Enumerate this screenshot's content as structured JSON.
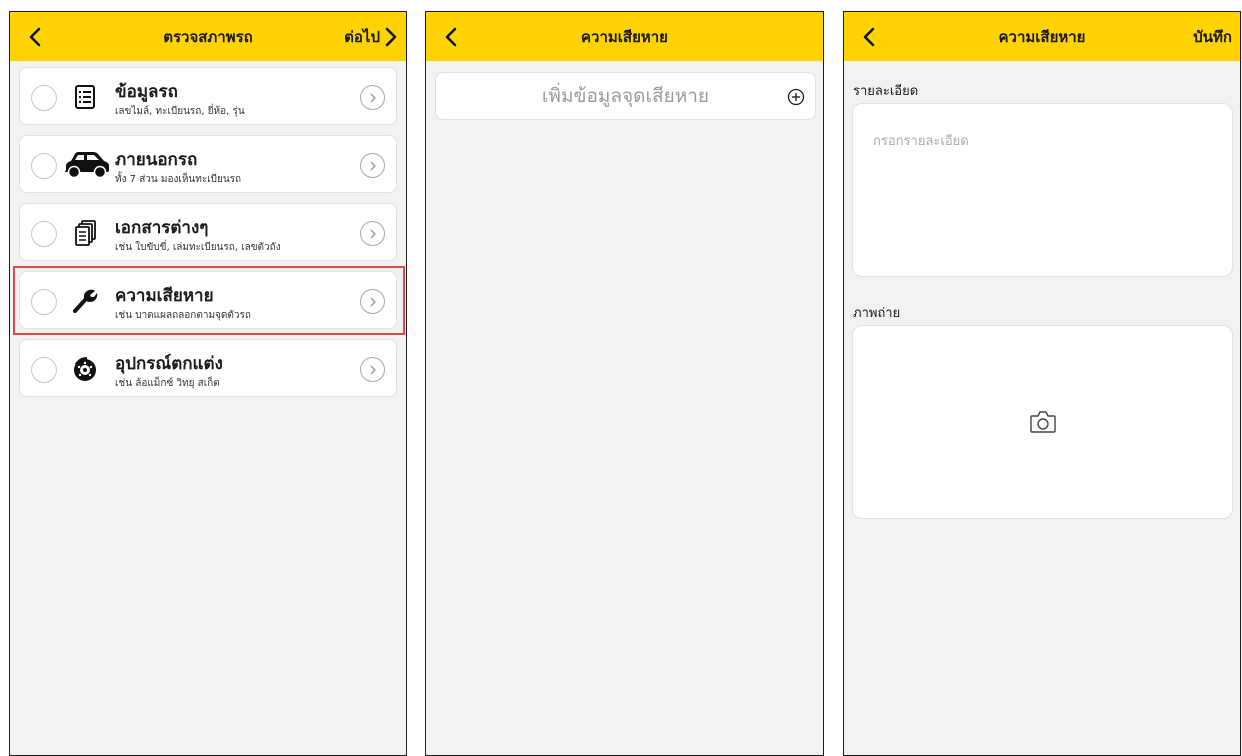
{
  "screen1": {
    "title": "ตรวจสภาพรถ",
    "next_label": "ต่อไป",
    "items": [
      {
        "title": "ข้อมูลรถ",
        "subtitle": "เลขไมล์, ทะเบียนรถ, ยี่ห้อ, รุ่น",
        "icon": "list-icon"
      },
      {
        "title": "ภายนอกรถ",
        "subtitle": "ทั้ง 7 ส่วน มองเห็นทะเบียนรถ",
        "icon": "car-icon"
      },
      {
        "title": "เอกสารต่างๆ",
        "subtitle": "เช่น ใบขับขี่, เล่มทะเบียนรถ, เลขตัวถัง",
        "icon": "documents-icon"
      },
      {
        "title": "ความเสียหาย",
        "subtitle": "เช่น บาดแผลถลอกตามจุดตัวรถ",
        "icon": "wrench-icon"
      },
      {
        "title": "อุปกรณ์ตกแต่ง",
        "subtitle": "เช่น ล้อแม็กซ์ วิทยุ สเก็ต",
        "icon": "brake-disc-icon"
      }
    ]
  },
  "screen2": {
    "title": "ความเสียหาย",
    "add_label": "เพิ่มข้อมูลจุดเสียหาย"
  },
  "screen3": {
    "title": "ความเสียหาย",
    "save_label": "บันทึก",
    "detail_label": "รายละเอียด",
    "detail_placeholder": "กรอกรายละเอียด",
    "photo_label": "ภาพถ่าย"
  },
  "colors": {
    "header": "#ffd200",
    "background": "#f2f2f2",
    "highlight": "#e0484e"
  }
}
